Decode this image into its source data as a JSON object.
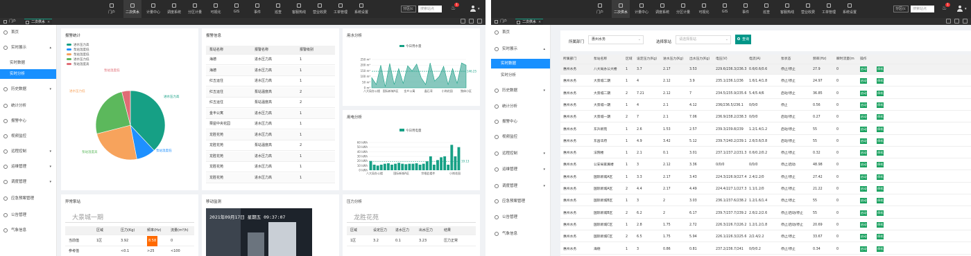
{
  "nav": [
    "门户",
    "二次供水",
    "计量中心",
    "调度系统",
    "分区计量",
    "可视化",
    "GIS",
    "事件",
    "巡查",
    "客服热线",
    "营业收费",
    "工单管理",
    "系统设置"
  ],
  "nav_active": 1,
  "topbar": {
    "select": "分区(c",
    "search_placeholder": "搜索站点",
    "badge": "1",
    "user": ""
  },
  "tabs": [
    {
      "label": "门户"
    },
    {
      "label": "二次供水",
      "active": true
    }
  ],
  "menu": {
    "home": "首页",
    "realtime": "实时展示",
    "realtime_data": "实时数据",
    "realtime_analysis": "实时分析",
    "history": "历史数据",
    "stats": "统计分析",
    "alarm": "报警中心",
    "video": "视频监控",
    "remote": "远程控制",
    "ops": "运维管理",
    "dispatch": "调度管理",
    "emergency": "应急预案管理",
    "bulletin": "公告管理",
    "weather": "气象信息"
  },
  "left": {
    "alarm_stats": {
      "title": "报警统计",
      "legend": [
        "进水压力高",
        "泵站温度低",
        "泵站温度低",
        "进水压力低",
        "泵站温度高"
      ],
      "colors": [
        "#16a085",
        "#1e90ff",
        "#f7a35c",
        "#5cb85c",
        "#e06c75"
      ],
      "slices": [
        38,
        9,
        24,
        25,
        4
      ],
      "labels": [
        "进水压力高",
        "泵站温度低",
        "进水压力低",
        "泵站温度高",
        "泵站温度低"
      ]
    },
    "alarm_info": {
      "title": "报警信息",
      "headers": [
        "泵站名称",
        "报警名称",
        "报警级别"
      ],
      "rows": [
        [
          "海德",
          "进水压力高",
          "1"
        ],
        [
          "海德",
          "进水压力高",
          "1"
        ],
        [
          "红五运住",
          "进水压力高",
          "1"
        ],
        [
          "红五运住",
          "泵站温度高",
          "2"
        ],
        [
          "红五运住",
          "泵站温度高",
          "2"
        ],
        [
          "金丰公寓",
          "进水压力高",
          "1"
        ],
        [
          "栗屋中央花园",
          "进水压力高",
          "1"
        ],
        [
          "龙胜花苑",
          "进水压力高",
          "1"
        ],
        [
          "龙胜花苑",
          "泵站温度高",
          "2"
        ],
        [
          "龙胜花苑",
          "进水压力高",
          "1"
        ],
        [
          "龙胜花苑",
          "进水压力高",
          "1"
        ],
        [
          "龙胜花苑",
          "进水压力高",
          "1"
        ]
      ]
    },
    "water_analysis": {
      "title": "用水分析",
      "legend": "今日用水量",
      "ticks": [
        "250 m³",
        "200 m³",
        "150 m³",
        "100 m³",
        "50 m³",
        "0 m³"
      ],
      "xlabels": [
        "八大局办公楼",
        "国际新城A区",
        "金乡公寓",
        "逢石湾",
        "小岗花园",
        "独体小区"
      ],
      "avg_label": "146.25"
    },
    "power_analysis": {
      "title": "用电分析",
      "legend": "今日用电量",
      "ticks": [
        "60 kWh",
        "50 kWh",
        "40 kWh",
        "30 kWh",
        "20 kWh",
        "10 kWh",
        "0 kWh"
      ],
      "xlabels": [
        "八大局办公楼",
        "国际新城A区",
        "宗根此楼件",
        "小岗花园"
      ],
      "avg_label": "19.13"
    },
    "abnormal": {
      "title": "异常泵站",
      "station": "大景城一期",
      "headers": [
        "区域",
        "压力(Kg)",
        "频率(Hz)",
        "流量(m³/h)"
      ],
      "rows": [
        [
          "当前值",
          "1区",
          "3.92",
          "8.58",
          "0"
        ],
        [
          "参考值",
          "",
          "<0.1",
          ">25",
          "<100"
        ]
      ]
    },
    "video": {
      "title": "移动监测",
      "timestamp": "2021年09月17日 星期五 09:37:07"
    },
    "pressure": {
      "title": "压力分析",
      "station": "龙胜花苑",
      "headers": [
        "区域",
        "设定压力",
        "进水压力",
        "出水压力",
        "结果"
      ],
      "rows": [
        [
          "1区",
          "3.2",
          "0.1",
          "3.23",
          "压力正常"
        ]
      ]
    }
  },
  "right": {
    "filter": {
      "dept_label": "所属部门",
      "dept_value": "惠州水务",
      "station_label": "选择泵站",
      "station_placeholder": "请选择泵站",
      "query": "查询"
    },
    "headers": [
      "所属部门",
      "泵站名称",
      "区域",
      "设定压力(Kg)",
      "进水压力(Kg)",
      "出水压力(Kg)",
      "电压(V)",
      "电流(A)",
      "泵状态",
      "频率(Hz)",
      "瞬时流量(m",
      "操作"
    ],
    "start_label": "启动",
    "stop_label": "停机",
    "rows": [
      [
        "惠州水务",
        "八大局办公大楼",
        "1",
        "3.7",
        "2.17",
        "3.53",
        "229.6/236.3/236.3",
        "0.6/0.6/0.6",
        "停止/停止",
        "27.9",
        "0"
      ],
      [
        "惠州水务",
        "大景城二期",
        "1",
        "4",
        "2.12",
        "3.9",
        "235.1/236.1/236",
        "1.6/1.4/1.8",
        "停止/停止",
        "24.97",
        "0"
      ],
      [
        "惠州水务",
        "大景城二期",
        "2",
        "7.21",
        "2.12",
        "7",
        "234.5/235.9/235.6",
        "5.4/5.4/6",
        "启动/停止",
        "36.85",
        "0"
      ],
      [
        "惠州水务",
        "大景城一期",
        "1",
        "4",
        "2.1",
        "4.12",
        "236/236.5/236.1",
        "0/0/0",
        "停止",
        "0.56",
        "0"
      ],
      [
        "惠州水务",
        "大景城一期",
        "2",
        "7",
        "2.1",
        "7.06",
        "236.9/238.2/238.3",
        "0/0/0",
        "启动/停止",
        "0.27",
        "0"
      ],
      [
        "惠州水务",
        "东升新苑",
        "1",
        "2.6",
        "1.53",
        "2.57",
        "239.3/239.8/239",
        "1.2/1.4/1.2",
        "启动/停止",
        "55",
        "0"
      ],
      [
        "惠州水务",
        "东昌华府",
        "1",
        "4.9",
        "3.42",
        "5.12",
        "239.7/240.2/239.1",
        "2.6/3.6/3.8",
        "启动/停止",
        "55",
        "0"
      ],
      [
        "惠州水务",
        "法院楼",
        "1",
        "2.1",
        "0.1",
        "3.01",
        "237.1/237.2/231.3",
        "0.6/0.2/0.2",
        "停止/停止",
        "0.32",
        "0"
      ],
      [
        "惠州水务",
        "公安局家属楼",
        "1",
        "3",
        "2.12",
        "3.36",
        "0/0/0",
        "0/0/0",
        "停止/启动",
        "48.98",
        "0"
      ],
      [
        "惠州水务",
        "国际新城A区",
        "1",
        "3.3",
        "2.17",
        "3.43",
        "224.3/226.9/227.4",
        "2.4/2.2/0",
        "停止/停止",
        "27.42",
        "0"
      ],
      [
        "惠州水务",
        "国际新城A区",
        "2",
        "4.4",
        "2.17",
        "4.49",
        "224.4/227.1/227.3",
        "1.1/1.2/0",
        "停止/停止",
        "21.22",
        "0"
      ],
      [
        "惠州水务",
        "国际新城B区",
        "1",
        "3",
        "2",
        "3.03",
        "236.1/237.6/238.2",
        "1.2/1.6/1.4",
        "停止/停止",
        "55",
        "0"
      ],
      [
        "惠州水务",
        "国际新城B区",
        "2",
        "6.2",
        "2",
        "6.17",
        "239.7/237.7/239.2",
        "2.6/2.2/2.6",
        "停止/启动/停止",
        "55",
        "0"
      ],
      [
        "惠州水务",
        "国际新城C区",
        "1",
        "2.8",
        "1.75",
        "2.72",
        "226.3/226.7/226.2",
        "1.2/1.2/1.8",
        "停止/启动/停止",
        "20.69",
        "0"
      ],
      [
        "惠州水务",
        "国际新城C区",
        "2",
        "6.5",
        "1.75",
        "5.94",
        "226.1/226.3/225.6",
        "2/2.4/2.2",
        "停止/停止",
        "33.67",
        "0"
      ],
      [
        "惠州水务",
        "海德",
        "1",
        "3",
        "0.86",
        "0.81",
        "237.2/236.7/241",
        "0/0/0.2",
        "停止/停止",
        "0.34",
        "0"
      ]
    ]
  }
}
